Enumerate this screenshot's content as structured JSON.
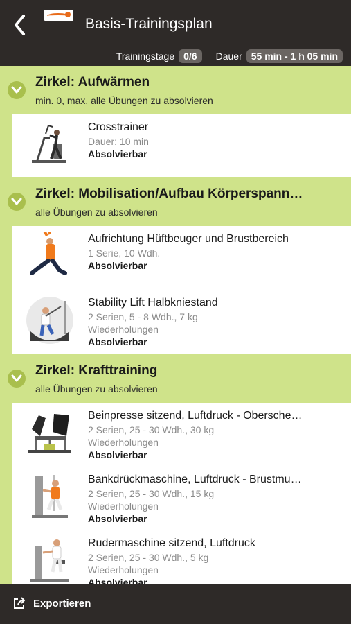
{
  "header": {
    "title": "Basis-Trainingsplan",
    "training_days_label": "Trainingstage",
    "training_days_value": "0/6",
    "duration_label": "Dauer",
    "duration_value": "55 min - 1 h 05 min"
  },
  "sections": [
    {
      "title": "Zirkel: Aufwärmen",
      "subtitle": "min. 0, max. alle Übungen zu absolvieren",
      "items": [
        {
          "name": "Crosstrainer",
          "line2": "Dauer: 10 min",
          "status": "Absolvierbar"
        }
      ]
    },
    {
      "title": "Zirkel: Mobilisation/Aufbau Körperspann…",
      "subtitle": "alle Übungen zu absolvieren",
      "items": [
        {
          "name": "Aufrichtung Hüftbeuger und Brustbereich",
          "line2": "1 Serie, 10 Wdh.",
          "status": "Absolvierbar"
        },
        {
          "name": "Stability Lift Halbkniestand",
          "line2": "2 Serien, 5 - 8 Wdh., 7 kg",
          "line3": "Wiederholungen",
          "status": "Absolvierbar"
        }
      ]
    },
    {
      "title": "Zirkel: Krafttraining",
      "subtitle": "alle Übungen zu absolvieren",
      "items": [
        {
          "name": "Beinpresse sitzend, Luftdruck - Obersche…",
          "line2": "2 Serien, 25 - 30 Wdh., 30 kg",
          "line3": "Wiederholungen",
          "status": "Absolvierbar"
        },
        {
          "name": "Bankdrückmaschine, Luftdruck - Brustmu…",
          "line2": "2 Serien, 25 - 30 Wdh., 15 kg",
          "line3": "Wiederholungen",
          "status": "Absolvierbar"
        },
        {
          "name": "Rudermaschine sitzend, Luftdruck",
          "line2": "2 Serien, 25 - 30 Wdh., 5 kg",
          "line3": "Wiederholungen",
          "status": "Absolvierbar"
        }
      ]
    }
  ],
  "footer": {
    "export_label": "Exportieren"
  },
  "icons": {
    "back": "chevron-left-icon",
    "collapse": "chevron-down-icon",
    "export": "share-export-icon"
  },
  "colors": {
    "header_bg": "#2e2a28",
    "section_bg": "#cfe38a",
    "chevron_circle": "#a9bf4d",
    "pill_bg": "#6a6562",
    "brand_orange": "#e86b1a"
  }
}
